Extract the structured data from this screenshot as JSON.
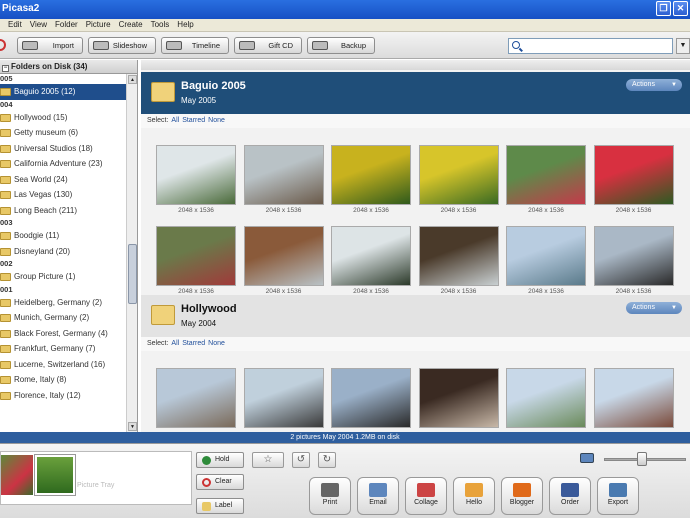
{
  "window": {
    "title": "Picasa2"
  },
  "menu": [
    "Edit",
    "View",
    "Folder",
    "Picture",
    "Create",
    "Tools",
    "Help"
  ],
  "toolbar": {
    "import": "Import",
    "slideshow": "Slideshow",
    "timeline": "Timeline",
    "giftcd": "Gift CD",
    "backup": "Backup"
  },
  "sidebar": {
    "header": "Folders on Disk (34)",
    "groups": [
      {
        "year": "005",
        "items": [
          {
            "label": "Baguio 2005 (12)",
            "selected": true
          }
        ]
      },
      {
        "year": "004",
        "items": [
          {
            "label": "Hollywood (15)"
          },
          {
            "label": "Getty museum (6)"
          },
          {
            "label": "Universal Studios (18)"
          },
          {
            "label": "California Adventure (23)"
          },
          {
            "label": "Sea World (24)"
          },
          {
            "label": "Las Vegas (130)"
          },
          {
            "label": "Long Beach (211)"
          }
        ]
      },
      {
        "year": "003",
        "items": [
          {
            "label": "Boodgie (11)"
          },
          {
            "label": "Disneyland (20)"
          }
        ]
      },
      {
        "year": "002",
        "items": [
          {
            "label": "Group Picture (1)"
          }
        ]
      },
      {
        "year": "001",
        "items": [
          {
            "label": "Heidelberg, Germany (2)"
          },
          {
            "label": "Munich, Germany (2)"
          },
          {
            "label": "Black Forest, Germany (4)"
          },
          {
            "label": "Frankfurt, Germany (7)"
          },
          {
            "label": "Lucerne, Switzerland (16)"
          },
          {
            "label": "Rome, Italy (8)"
          },
          {
            "label": "Florence, Italy (12)"
          }
        ]
      }
    ]
  },
  "albums": [
    {
      "title": "Baguio 2005",
      "date": "May 2005",
      "actions": "Actions",
      "select": {
        "label": "Select:",
        "all": "All",
        "starred": "Starred",
        "none": "None"
      },
      "photos": [
        {
          "caption": "2048 x 1536",
          "c1": "#dfe6e8",
          "c2": "#4a6a3a"
        },
        {
          "caption": "2048 x 1536",
          "c1": "#b9c2c6",
          "c2": "#6a5a4a"
        },
        {
          "caption": "2048 x 1536",
          "c1": "#c8b21e",
          "c2": "#2f5a1c"
        },
        {
          "caption": "2048 x 1536",
          "c1": "#d7c52a",
          "c2": "#3a6a22"
        },
        {
          "caption": "2048 x 1536",
          "c1": "#5e8a4a",
          "c2": "#c43a4a"
        },
        {
          "caption": "2048 x 1536",
          "c1": "#d83040",
          "c2": "#2e5a22"
        },
        {
          "caption": "2048 x 1536",
          "c1": "#6a7a4a",
          "c2": "#a03a3a"
        },
        {
          "caption": "2048 x 1536",
          "c1": "#8a5a3a",
          "c2": "#b9c2c6"
        },
        {
          "caption": "2048 x 1536",
          "c1": "#dde4e6",
          "c2": "#2c3a2a"
        },
        {
          "caption": "2048 x 1536",
          "c1": "#4a3a2a",
          "c2": "#c9d0d2"
        },
        {
          "caption": "2048 x 1536",
          "c1": "#b8cce0",
          "c2": "#5a7a8a"
        },
        {
          "caption": "2048 x 1536",
          "c1": "#aab8c6",
          "c2": "#2a2a2a"
        }
      ]
    },
    {
      "title": "Hollywood",
      "date": "May 2004",
      "actions": "Actions",
      "select": {
        "label": "Select:",
        "all": "All",
        "starred": "Starred",
        "none": "None"
      },
      "photos": [
        {
          "c1": "#b8c8d8",
          "c2": "#7a6a5a"
        },
        {
          "c1": "#c0d0dc",
          "c2": "#3a3a3a"
        },
        {
          "c1": "#9ab0c8",
          "c2": "#2a2a2a"
        },
        {
          "c1": "#3a2a22",
          "c2": "#c8b8a8"
        },
        {
          "c1": "#c8d8e8",
          "c2": "#6a8a5a"
        },
        {
          "c1": "#c8d8e8",
          "c2": "#7a4a3a"
        }
      ]
    }
  ],
  "status": "2 pictures     May 2004     1.2MB on disk",
  "tray": {
    "label": "Picture Tray",
    "hold": "Hold",
    "clear": "Clear",
    "labelbtn": "Label"
  },
  "actions_bar": [
    "Print",
    "Email",
    "Collage",
    "Hello",
    "Blogger",
    "Order",
    "Export"
  ],
  "zoom_level": 0.42
}
